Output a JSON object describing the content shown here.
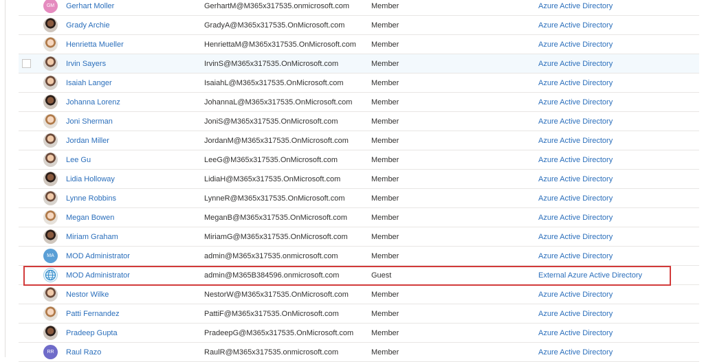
{
  "colors": {
    "link": "#2a6ebb",
    "highlight": "#d23a3a",
    "avatar_gm": "#e58bbf",
    "avatar_ma": "#5a9fd6",
    "avatar_rr": "#6f6bc9"
  },
  "users": [
    {
      "name": "Gerhart Moller",
      "email": "GerhartM@M365x317535.onmicrosoft.com",
      "type": "Member",
      "source": "Azure Active Directory",
      "avatar": "GM"
    },
    {
      "name": "Grady Archie",
      "email": "GradyA@M365x317535.OnMicrosoft.com",
      "type": "Member",
      "source": "Azure Active Directory",
      "avatar": ""
    },
    {
      "name": "Henrietta Mueller",
      "email": "HenriettaM@M365x317535.OnMicrosoft.com",
      "type": "Member",
      "source": "Azure Active Directory",
      "avatar": ""
    },
    {
      "name": "Irvin Sayers",
      "email": "IrvinS@M365x317535.OnMicrosoft.com",
      "type": "Member",
      "source": "Azure Active Directory",
      "avatar": ""
    },
    {
      "name": "Isaiah Langer",
      "email": "IsaiahL@M365x317535.OnMicrosoft.com",
      "type": "Member",
      "source": "Azure Active Directory",
      "avatar": ""
    },
    {
      "name": "Johanna Lorenz",
      "email": "JohannaL@M365x317535.OnMicrosoft.com",
      "type": "Member",
      "source": "Azure Active Directory",
      "avatar": ""
    },
    {
      "name": "Joni Sherman",
      "email": "JoniS@M365x317535.OnMicrosoft.com",
      "type": "Member",
      "source": "Azure Active Directory",
      "avatar": ""
    },
    {
      "name": "Jordan Miller",
      "email": "JordanM@M365x317535.OnMicrosoft.com",
      "type": "Member",
      "source": "Azure Active Directory",
      "avatar": ""
    },
    {
      "name": "Lee Gu",
      "email": "LeeG@M365x317535.OnMicrosoft.com",
      "type": "Member",
      "source": "Azure Active Directory",
      "avatar": ""
    },
    {
      "name": "Lidia Holloway",
      "email": "LidiaH@M365x317535.OnMicrosoft.com",
      "type": "Member",
      "source": "Azure Active Directory",
      "avatar": ""
    },
    {
      "name": "Lynne Robbins",
      "email": "LynneR@M365x317535.OnMicrosoft.com",
      "type": "Member",
      "source": "Azure Active Directory",
      "avatar": ""
    },
    {
      "name": "Megan Bowen",
      "email": "MeganB@M365x317535.OnMicrosoft.com",
      "type": "Member",
      "source": "Azure Active Directory",
      "avatar": ""
    },
    {
      "name": "Miriam Graham",
      "email": "MiriamG@M365x317535.OnMicrosoft.com",
      "type": "Member",
      "source": "Azure Active Directory",
      "avatar": ""
    },
    {
      "name": "MOD Administrator",
      "email": "admin@M365x317535.onmicrosoft.com",
      "type": "Member",
      "source": "Azure Active Directory",
      "avatar": "MA"
    },
    {
      "name": "MOD Administrator",
      "email": "admin@M365B384596.onmicrosoft.com",
      "type": "Guest",
      "source": "External Azure Active Directory",
      "avatar": ""
    },
    {
      "name": "Nestor Wilke",
      "email": "NestorW@M365x317535.OnMicrosoft.com",
      "type": "Member",
      "source": "Azure Active Directory",
      "avatar": ""
    },
    {
      "name": "Patti Fernandez",
      "email": "PattiF@M365x317535.OnMicrosoft.com",
      "type": "Member",
      "source": "Azure Active Directory",
      "avatar": ""
    },
    {
      "name": "Pradeep Gupta",
      "email": "PradeepG@M365x317535.OnMicrosoft.com",
      "type": "Member",
      "source": "Azure Active Directory",
      "avatar": ""
    },
    {
      "name": "Raul Razo",
      "email": "RaulR@M365x317535.onmicrosoft.com",
      "type": "Member",
      "source": "Azure Active Directory",
      "avatar": "RR"
    }
  ]
}
